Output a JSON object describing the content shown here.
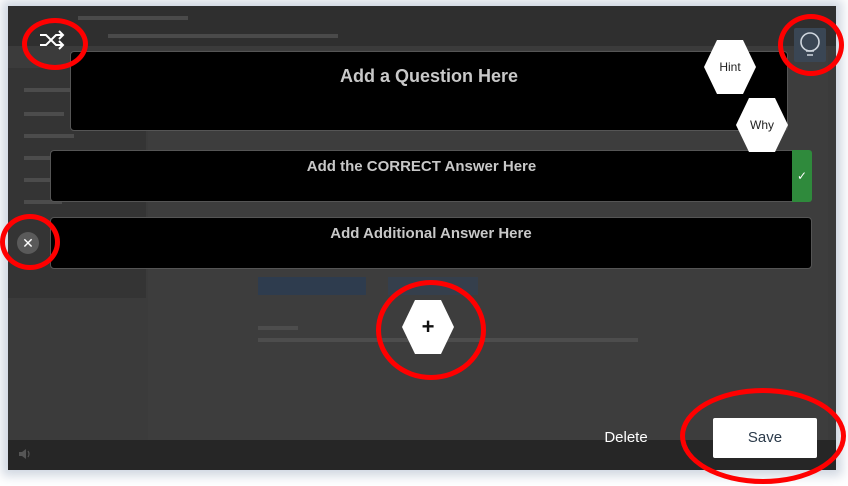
{
  "editor": {
    "question_placeholder": "Add a Question Here",
    "correct_answer_placeholder": "Add the CORRECT Answer Here",
    "additional_answer_placeholder": "Add Additional Answer Here",
    "hint_label": "Hint",
    "why_label": "Why",
    "add_label": "+",
    "remove_label": "✕",
    "correct_mark": "✓"
  },
  "footer": {
    "delete_label": "Delete",
    "save_label": "Save"
  },
  "icons": {
    "shuffle": "shuffle-icon",
    "bulb": "lightbulb-icon",
    "speaker": "speaker-icon"
  },
  "colors": {
    "highlight": "#ff0000",
    "correct": "#2f8a3c",
    "overlay": "#3b3b3b",
    "save_text": "#2b3a4a"
  }
}
